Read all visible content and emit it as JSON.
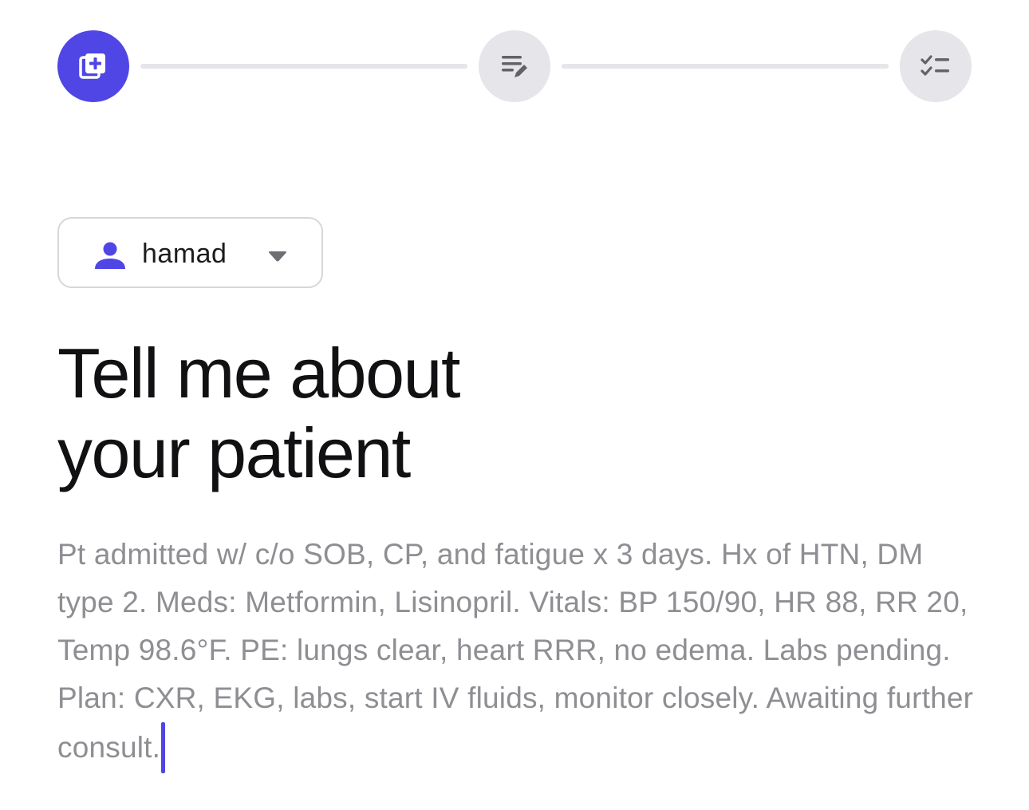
{
  "stepper": {
    "steps": [
      {
        "icon": "add-note-icon",
        "state": "active"
      },
      {
        "icon": "edit-list-icon",
        "state": "inactive"
      },
      {
        "icon": "checklist-icon",
        "state": "inactive"
      }
    ],
    "active_color": "#4f46e5",
    "inactive_color": "#e5e5ea"
  },
  "patient_select": {
    "icon": "person-icon",
    "value": "hamad",
    "dropdown_icon": "caret-down-icon"
  },
  "heading": {
    "line1": "Tell me about",
    "line2": "your patient"
  },
  "notes": {
    "text": "Pt admitted w/ c/o SOB, CP, and fatigue x 3 days. Hx of HTN, DM type 2. Meds: Metformin, Lisinopril. Vitals: BP 150/90, HR 88, RR 20, Temp 98.6°F. PE: lungs clear, heart RRR, no edema. Labs pending. Plan: CXR, EKG, labs, start IV fluids, monitor closely. Awaiting further consult."
  }
}
